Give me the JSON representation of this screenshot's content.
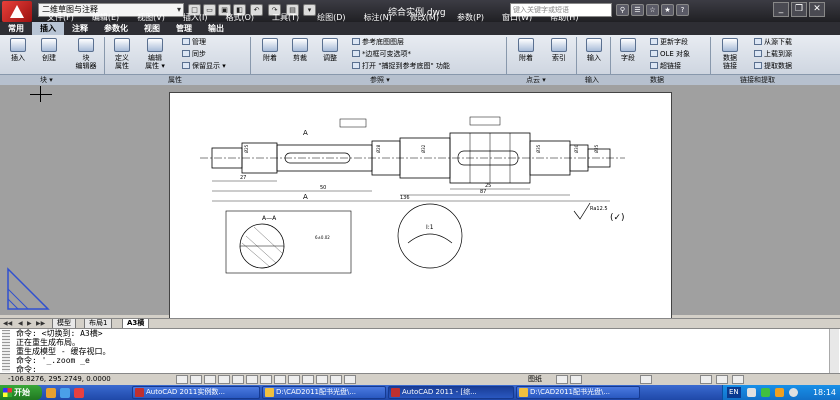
{
  "window": {
    "workspace": "二维草图与注释",
    "doc_title": "综合实例.dwg",
    "search_placeholder": "键入关键字或短语"
  },
  "menu": [
    "文件(F)",
    "编辑(E)",
    "视图(V)",
    "插入(I)",
    "格式(O)",
    "工具(T)",
    "绘图(D)",
    "标注(N)",
    "修改(M)",
    "参数(P)",
    "窗口(W)",
    "帮助(H)"
  ],
  "ribbon_tabs": [
    "常用",
    "插入",
    "注释",
    "参数化",
    "视图",
    "管理",
    "输出"
  ],
  "ribbon": {
    "block": {
      "insert": "插入",
      "create": "创建",
      "block_editor_1": "块",
      "block_editor_2": "编辑器",
      "label": "块 ▾"
    },
    "attributes": {
      "define_1": "定义",
      "define_2": "属性",
      "edit_1": "编辑",
      "edit_2": "属性 ▾",
      "manage": "管理",
      "sync": "同步",
      "retain": "保留显示 ▾",
      "label": "属性"
    },
    "reference": {
      "attach": "附着",
      "clip": "剪裁",
      "adjust": "调整",
      "underlay_layers": "参考底图图层",
      "frame_var": "*边框可变选项*",
      "snap_underlay": "打开 \"捕捉到参考底图\" 功能",
      "label": "参照 ▾"
    },
    "pointcloud": {
      "attach": "附着",
      "index": "索引",
      "label": "点云 ▾"
    },
    "import": {
      "import": "输入",
      "label": "输入"
    },
    "data": {
      "field": "字段",
      "update_fields": "更新字段",
      "ole": "OLE 对象",
      "hyperlink": "超链接",
      "label": "数据"
    },
    "linking": {
      "data_link_1": "数据",
      "data_link_2": "链接",
      "download": "从源下载",
      "upload": "上载到源",
      "extract": "提取数据",
      "label": "链接和提取"
    }
  },
  "drawing": {
    "section_label": "A—A",
    "detail_label": "I:1",
    "roughness": "Ra12.5",
    "dims": [
      "27",
      "50",
      "87",
      "Ø25",
      "Ø28",
      "Ø32",
      "Ø35",
      "Ø30",
      "Ø25",
      "25",
      "136",
      "A",
      "A",
      "6±0.02"
    ]
  },
  "layout_tabs": [
    "模型",
    "布局1",
    "A3横"
  ],
  "command": {
    "lines": [
      "命令: <切换到: A3横>",
      "正在重生成布局。",
      "重生成模型 - 缓存视口。",
      "命令: '_.zoom _e",
      "命令:"
    ]
  },
  "status": {
    "coords": "-106.8276, 295.2749, 0.0000",
    "paper": "图纸"
  },
  "taskbar": {
    "start": "开始",
    "tasks": [
      "AutoCAD 2011实例数...",
      "D:\\CAD2011配书光盘\\...",
      "AutoCAD 2011 - [综...",
      "D:\\CAD2011配书光盘\\..."
    ],
    "lang": "EN",
    "clock": "18:14"
  },
  "colors": {
    "title_bg": "#2c2c32",
    "ribbon_bg": "#dbe2ec",
    "canvas_bg": "#a0a0a0",
    "taskbar_bg": "#2a58c0",
    "start_green": "#2f9a2f"
  }
}
